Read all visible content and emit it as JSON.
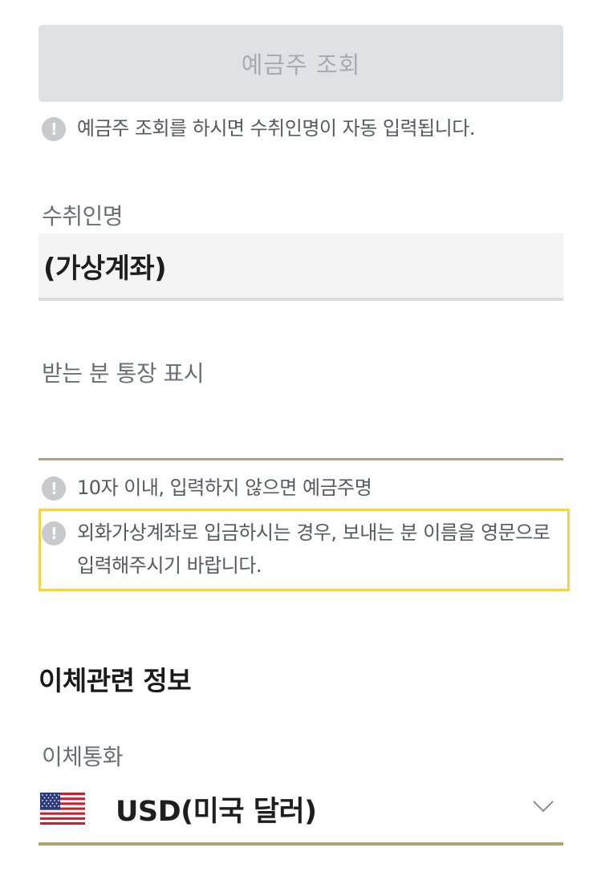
{
  "inquiry": {
    "button_label": "예금주 조회",
    "notice": "예금주 조회를 하시면 수취인명이 자동 입력됩니다."
  },
  "recipient": {
    "label": "수취인명",
    "value": "(가상계좌)"
  },
  "display_name": {
    "label": "받는 분 통장 표시",
    "value": "",
    "notice": "10자 이내, 입력하지 않으면 예금주명",
    "warning": "외화가상계좌로 입금하시는 경우, 보내는 분 이름을 영문으로 입력해주시기 바랍니다."
  },
  "transfer_info": {
    "section_title": "이체관련 정보",
    "currency_label": "이체통화",
    "currency_value": "USD(미국 달러)",
    "flag_icon": "us-flag-icon",
    "chevron_icon": "chevron-down-icon"
  },
  "colors": {
    "accent_gold": "#b3a273",
    "warning_yellow": "#f1d34c",
    "disabled_button": "#dfe1e4"
  }
}
